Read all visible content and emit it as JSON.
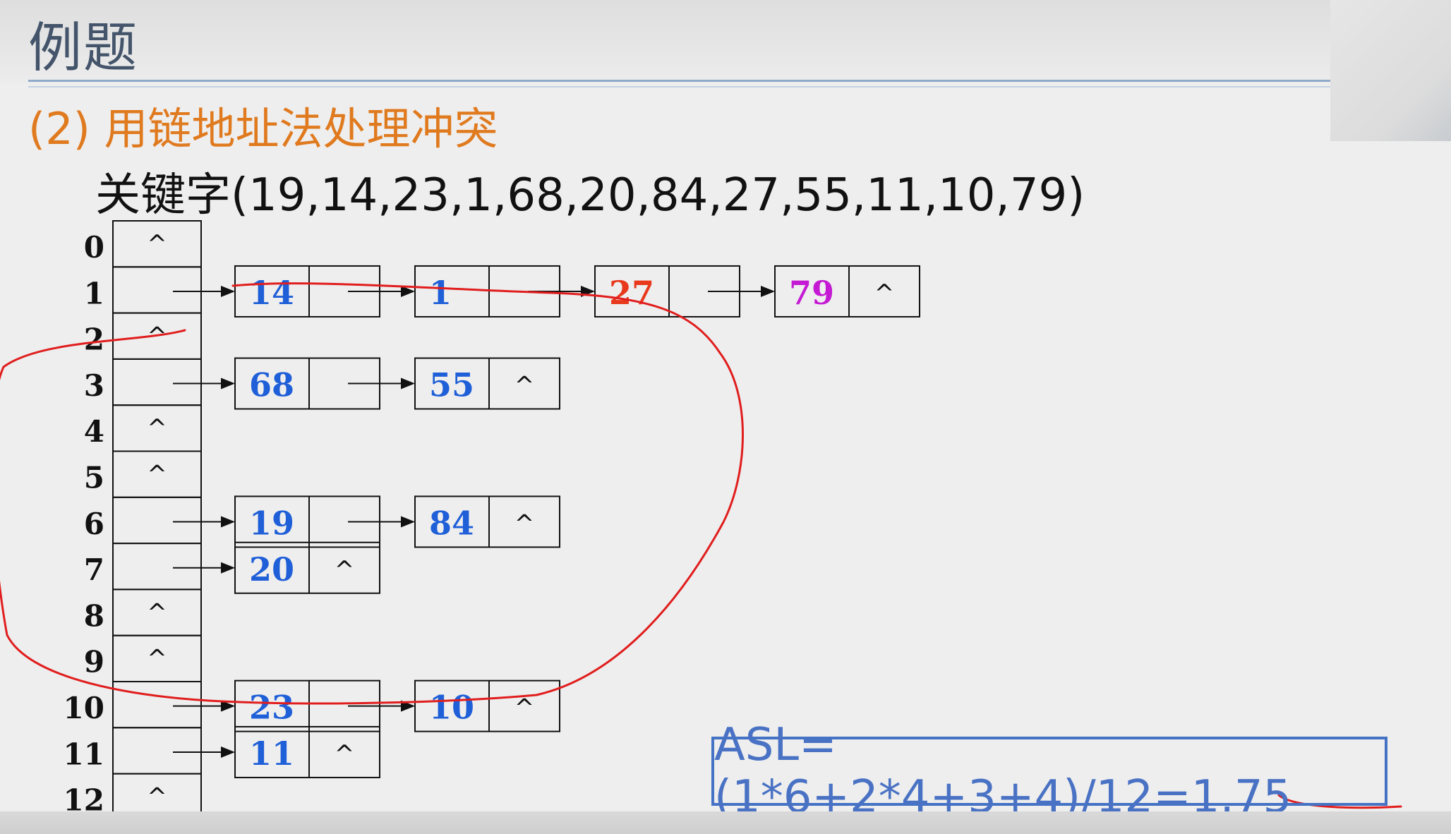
{
  "slide": {
    "title": "例题",
    "subtitle": "(2)  用链地址法处理冲突",
    "keywords": "关键字(19,14,23,1,68,20,84,27,55,11,10,79)"
  },
  "table": {
    "indices": [
      "0",
      "1",
      "2",
      "3",
      "4",
      "5",
      "6",
      "7",
      "8",
      "9",
      "10",
      "11",
      "12"
    ],
    "empty_slots": [
      0,
      2,
      4,
      5,
      8,
      9,
      12
    ],
    "null_symbol": "^"
  },
  "chains": [
    {
      "slot": 1,
      "nodes": [
        {
          "key": "14",
          "color": "#1f5fd8"
        },
        {
          "key": "1",
          "color": "#1f5fd8"
        },
        {
          "key": "27",
          "color": "#e8391c"
        },
        {
          "key": "79",
          "color": "#c51ad4"
        }
      ]
    },
    {
      "slot": 3,
      "nodes": [
        {
          "key": "68",
          "color": "#1f5fd8"
        },
        {
          "key": "55",
          "color": "#1f5fd8"
        }
      ]
    },
    {
      "slot": 6,
      "nodes": [
        {
          "key": "19",
          "color": "#1f5fd8"
        },
        {
          "key": "84",
          "color": "#1f5fd8"
        }
      ]
    },
    {
      "slot": 7,
      "nodes": [
        {
          "key": "20",
          "color": "#1f5fd8"
        }
      ]
    },
    {
      "slot": 10,
      "nodes": [
        {
          "key": "23",
          "color": "#1f5fd8"
        },
        {
          "key": "10",
          "color": "#1f5fd8"
        }
      ]
    },
    {
      "slot": 11,
      "nodes": [
        {
          "key": "11",
          "color": "#1f5fd8"
        }
      ]
    }
  ],
  "asl": {
    "formula": "ASL=(1*6+2*4+3+4)/12=1.75"
  },
  "colors": {
    "title": "#44546a",
    "subtitle": "#e07a1f",
    "asl_border": "#4472c4",
    "annotation": "#e11d1d"
  }
}
